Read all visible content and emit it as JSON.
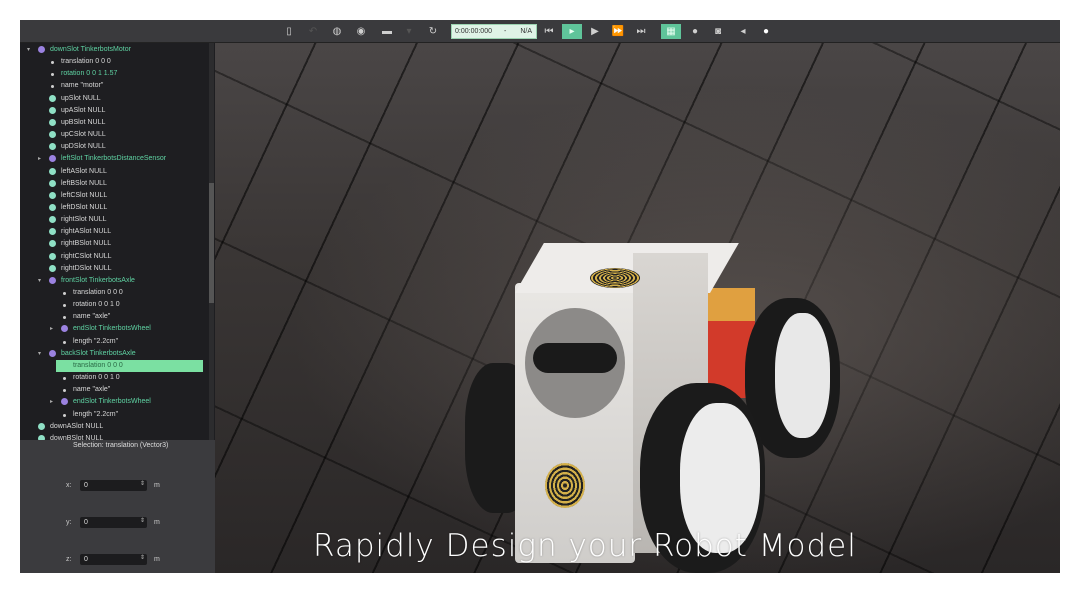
{
  "toolbar": {
    "time": "0:00:00:000",
    "time_sep": "-",
    "speed": "N/A",
    "icons": [
      "scene-tree-toggle-icon",
      "undo-icon",
      "globe-icon",
      "eye-icon",
      "open-folder-icon",
      "save-icon",
      "reload-icon",
      "reset-icon",
      "pause-icon",
      "play-icon",
      "fast-forward-icon",
      "fastest-icon",
      "render-icon",
      "record-icon",
      "camera-icon",
      "sound-icon",
      "light-icon"
    ]
  },
  "tree": [
    {
      "label": "downSlot TinkerbotsMotor",
      "type": "node",
      "level": 0,
      "expanded": true
    },
    {
      "label": "translation 0 0 0",
      "type": "field",
      "level": 1
    },
    {
      "label": "rotation 0 0 1 1.57",
      "type": "field",
      "level": 1,
      "modified": true
    },
    {
      "label": "name \"motor\"",
      "type": "field",
      "level": 1
    },
    {
      "label": "upSlot NULL",
      "type": "null",
      "level": 1
    },
    {
      "label": "upASlot NULL",
      "type": "null",
      "level": 1
    },
    {
      "label": "upBSlot NULL",
      "type": "null",
      "level": 1
    },
    {
      "label": "upCSlot NULL",
      "type": "null",
      "level": 1
    },
    {
      "label": "upDSlot NULL",
      "type": "null",
      "level": 1
    },
    {
      "label": "leftSlot TinkerbotsDistanceSensor",
      "type": "node",
      "level": 1,
      "expanded": false
    },
    {
      "label": "leftASlot NULL",
      "type": "null",
      "level": 1
    },
    {
      "label": "leftBSlot NULL",
      "type": "null",
      "level": 1
    },
    {
      "label": "leftCSlot NULL",
      "type": "null",
      "level": 1
    },
    {
      "label": "leftDSlot NULL",
      "type": "null",
      "level": 1
    },
    {
      "label": "rightSlot NULL",
      "type": "null",
      "level": 1
    },
    {
      "label": "rightASlot NULL",
      "type": "null",
      "level": 1
    },
    {
      "label": "rightBSlot NULL",
      "type": "null",
      "level": 1
    },
    {
      "label": "rightCSlot NULL",
      "type": "null",
      "level": 1
    },
    {
      "label": "rightDSlot NULL",
      "type": "null",
      "level": 1
    },
    {
      "label": "frontSlot TinkerbotsAxle",
      "type": "node",
      "level": 1,
      "expanded": true
    },
    {
      "label": "translation 0 0 0",
      "type": "field",
      "level": 2
    },
    {
      "label": "rotation 0 0 1 0",
      "type": "field",
      "level": 2
    },
    {
      "label": "name \"axle\"",
      "type": "field",
      "level": 2
    },
    {
      "label": "endSlot TinkerbotsWheel",
      "type": "node",
      "level": 2,
      "expanded": false
    },
    {
      "label": "length \"2.2cm\"",
      "type": "field",
      "level": 2
    },
    {
      "label": "backSlot TinkerbotsAxle",
      "type": "node",
      "level": 1,
      "expanded": true
    },
    {
      "label": "translation 0 0 0",
      "type": "field",
      "level": 2,
      "selected": true
    },
    {
      "label": "rotation 0 0 1 0",
      "type": "field",
      "level": 2
    },
    {
      "label": "name \"axle\"",
      "type": "field",
      "level": 2
    },
    {
      "label": "endSlot TinkerbotsWheel",
      "type": "node",
      "level": 2,
      "expanded": false
    },
    {
      "label": "length \"2.2cm\"",
      "type": "field",
      "level": 2
    },
    {
      "label": "downASlot NULL",
      "type": "null",
      "level": 0
    },
    {
      "label": "downBSlot NULL",
      "type": "null",
      "level": 0
    }
  ],
  "editor": {
    "selection": "Selection: translation (Vector3)",
    "fields": [
      {
        "label": "x:",
        "value": "0",
        "unit": "m"
      },
      {
        "label": "y:",
        "value": "0",
        "unit": "m"
      },
      {
        "label": "z:",
        "value": "0",
        "unit": "m"
      }
    ]
  },
  "caption": "Rapidly Design your Robot Model",
  "colors": {
    "accent": "#5fc49a",
    "node_text": "#5fd3a3",
    "proto_bullet": "#9b82e0",
    "null_bullet": "#8fe0c5"
  }
}
